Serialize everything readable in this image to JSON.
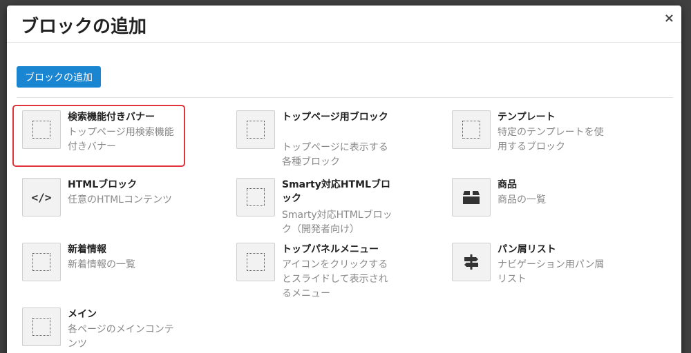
{
  "modal": {
    "title": "ブロックの追加",
    "close_label": "×",
    "add_button_label": "ブロックの追加"
  },
  "blocks": [
    {
      "name": "検索機能付きバナー",
      "desc": "トップページ用検索機能付きバナー",
      "icon": "dotted-square-icon",
      "selected": true
    },
    {
      "name": "トップページ用ブロック",
      "desc": "トップページに表示する各種ブロック",
      "icon": "dotted-square-icon"
    },
    {
      "name": "テンプレート",
      "desc": "特定のテンプレートを使用するブロック",
      "icon": "dotted-square-icon"
    },
    {
      "name": "HTMLブロック",
      "desc": "任意のHTMLコンテンツ",
      "icon": "code-icon"
    },
    {
      "name": "Smarty対応HTMLブロック",
      "desc": "Smarty対応HTMLブロック（開発者向け）",
      "icon": "dotted-square-icon"
    },
    {
      "name": "商品",
      "desc": "商品の一覧",
      "icon": "box-icon"
    },
    {
      "name": "新着情報",
      "desc": "新着情報の一覧",
      "icon": "dotted-square-icon"
    },
    {
      "name": "トップパネルメニュー",
      "desc": "アイコンをクリックするとスライドして表示されるメニュー",
      "icon": "dotted-square-icon"
    },
    {
      "name": "パン屑リスト",
      "desc": "ナビゲーション用パン屑リスト",
      "icon": "signpost-icon"
    },
    {
      "name": "メイン",
      "desc": "各ページのメインコンテンツ",
      "icon": "dotted-square-icon"
    }
  ],
  "colors": {
    "accent": "#1a85d0",
    "selected_border": "#e0333a"
  }
}
